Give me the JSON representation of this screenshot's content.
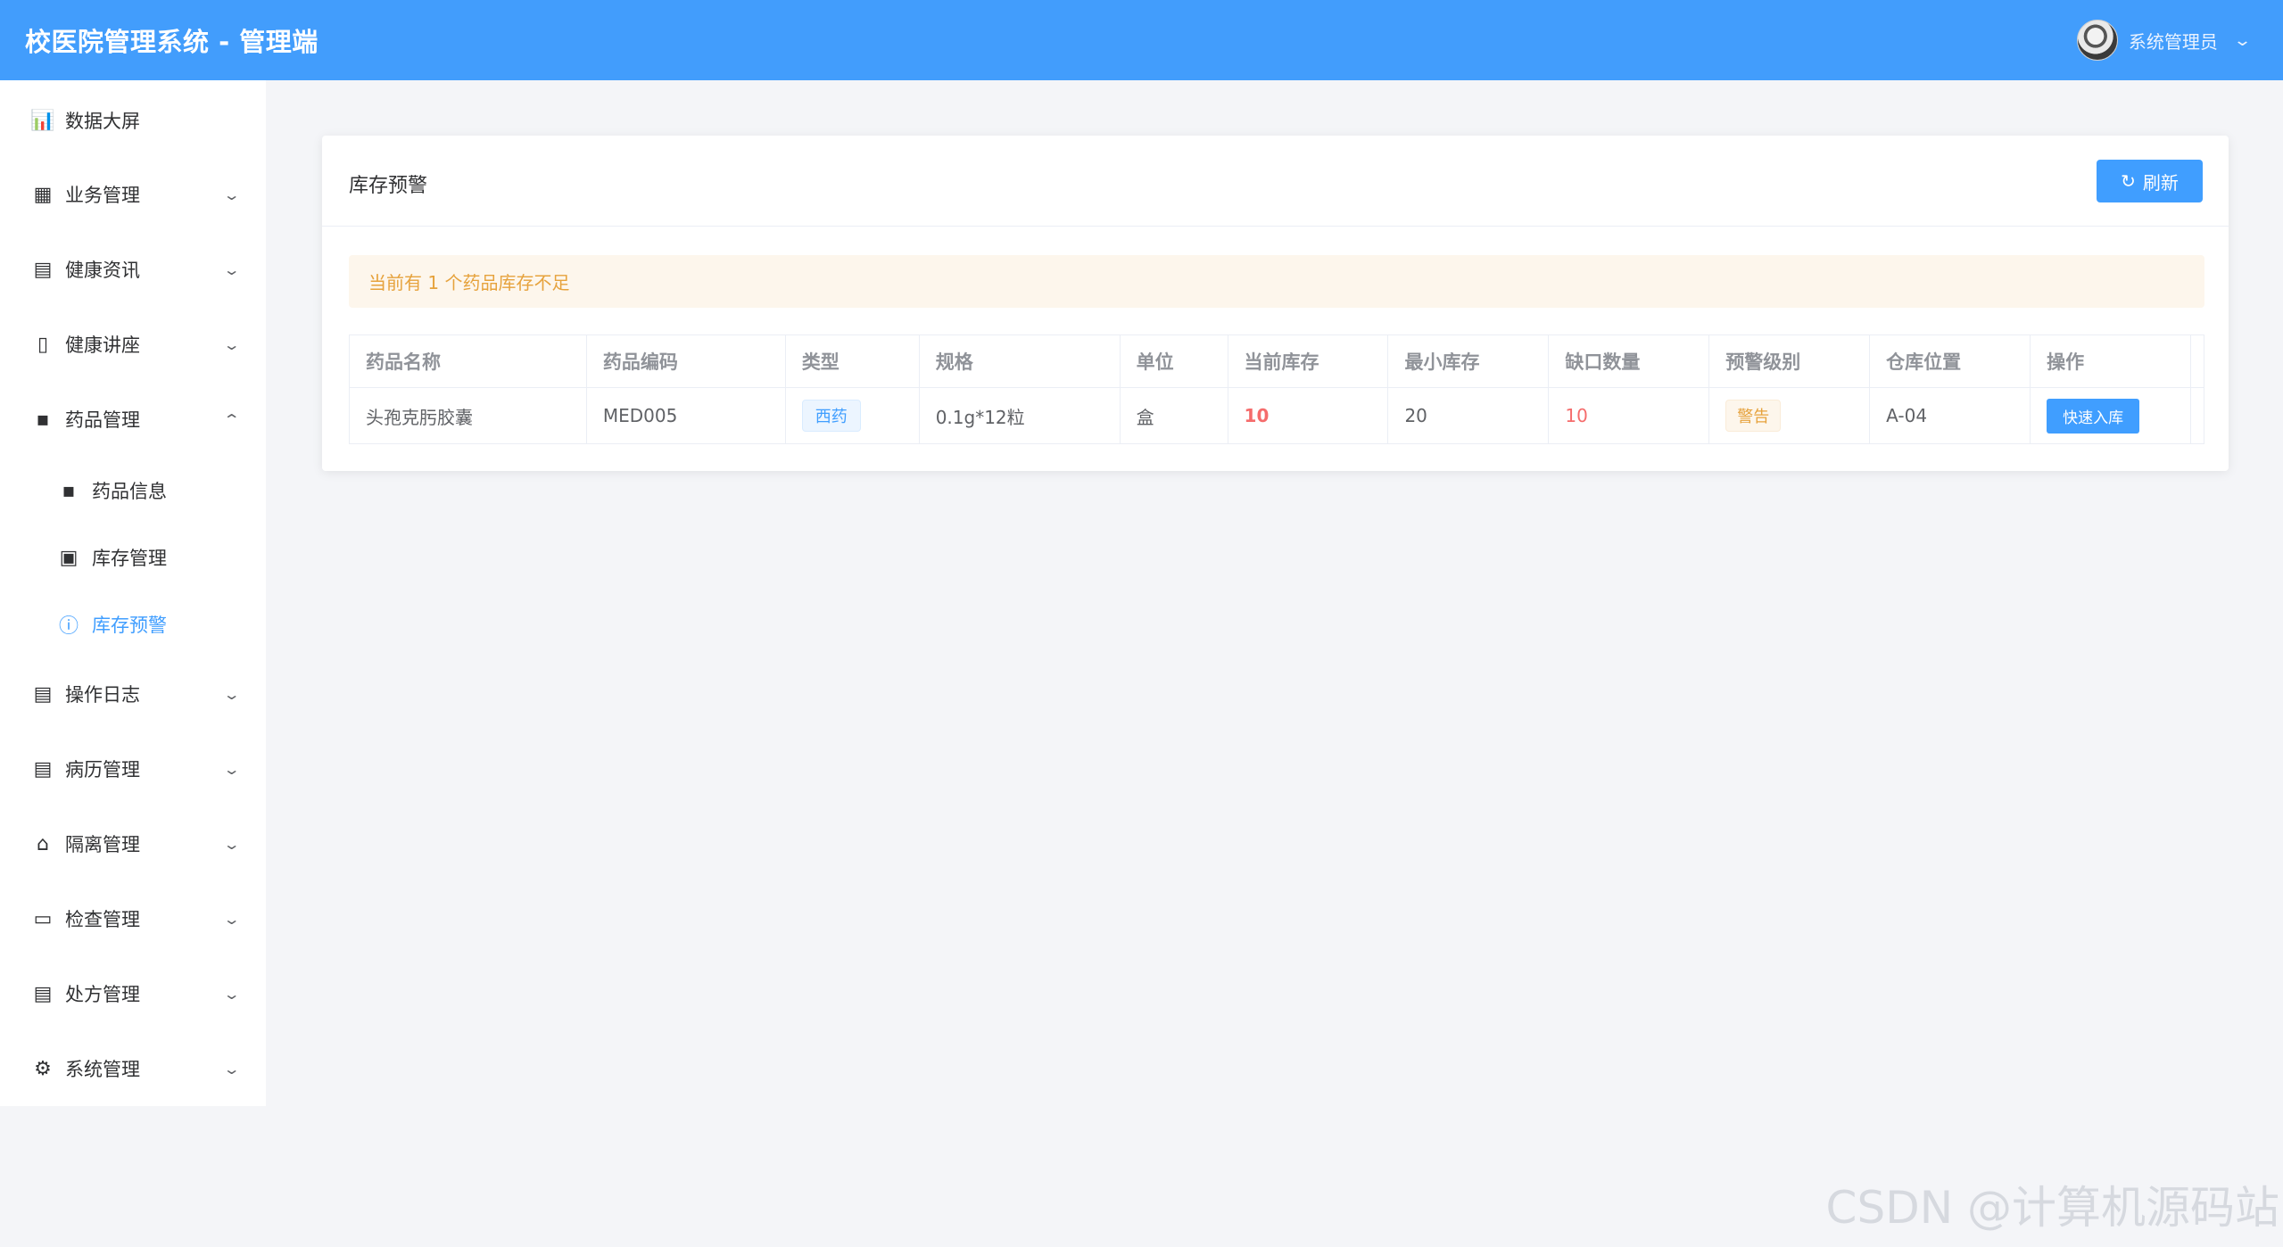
{
  "header": {
    "title": "校医院管理系统 - 管理端",
    "user_name": "系统管理员",
    "caret": "⌄"
  },
  "sidebar": {
    "items": [
      {
        "label": "数据大屏",
        "icon": "monitor-chart-icon",
        "glyph": "📊",
        "arrow": ""
      },
      {
        "label": "业务管理",
        "icon": "office-building-icon",
        "glyph": "▦",
        "arrow": "⌄"
      },
      {
        "label": "健康资讯",
        "icon": "document-icon",
        "glyph": "▤",
        "arrow": "⌄"
      },
      {
        "label": "健康讲座",
        "icon": "open-book-icon",
        "glyph": "▯",
        "arrow": "⌄"
      },
      {
        "label": "药品管理",
        "icon": "grid-menu-icon",
        "glyph": "▪",
        "arrow": "⌃"
      },
      {
        "label": "药品信息",
        "icon": "grid-menu-icon",
        "glyph": "▪",
        "arrow": ""
      },
      {
        "label": "库存管理",
        "icon": "box-icon",
        "glyph": "▣",
        "arrow": ""
      },
      {
        "label": "库存预警",
        "icon": "warning-circle-icon",
        "glyph": "ⓘ",
        "arrow": ""
      },
      {
        "label": "操作日志",
        "icon": "document-icon",
        "glyph": "▤",
        "arrow": "⌄"
      },
      {
        "label": "病历管理",
        "icon": "document-icon",
        "glyph": "▤",
        "arrow": "⌄"
      },
      {
        "label": "隔离管理",
        "icon": "house-icon",
        "glyph": "⌂",
        "arrow": "⌄"
      },
      {
        "label": "检查管理",
        "icon": "monitor-icon",
        "glyph": "▭",
        "arrow": "⌄"
      },
      {
        "label": "处方管理",
        "icon": "document-icon",
        "glyph": "▤",
        "arrow": "⌄"
      },
      {
        "label": "系统管理",
        "icon": "gear-icon",
        "glyph": "⚙",
        "arrow": "⌄"
      }
    ]
  },
  "card": {
    "title": "库存预警",
    "refresh_label": "刷新",
    "refresh_icon": "↻"
  },
  "alert": {
    "text": "当前有 1 个药品库存不足"
  },
  "table": {
    "columns": [
      "药品名称",
      "药品编码",
      "类型",
      "规格",
      "单位",
      "当前库存",
      "最小库存",
      "缺口数量",
      "预警级别",
      "仓库位置",
      "操作"
    ],
    "rows": [
      {
        "name": "头孢克肟胶囊",
        "code": "MED005",
        "type": "西药",
        "spec": "0.1g*12粒",
        "unit": "盒",
        "current": "10",
        "min": "20",
        "gap": "10",
        "level": "警告",
        "location": "A-04",
        "action": "快速入库"
      }
    ]
  },
  "watermark": "CSDN @计算机源码站",
  "colors": {
    "primary": "#409eff",
    "header_bg": "#429dfc",
    "warning": "#e6a23c",
    "danger": "#f56c6c"
  }
}
